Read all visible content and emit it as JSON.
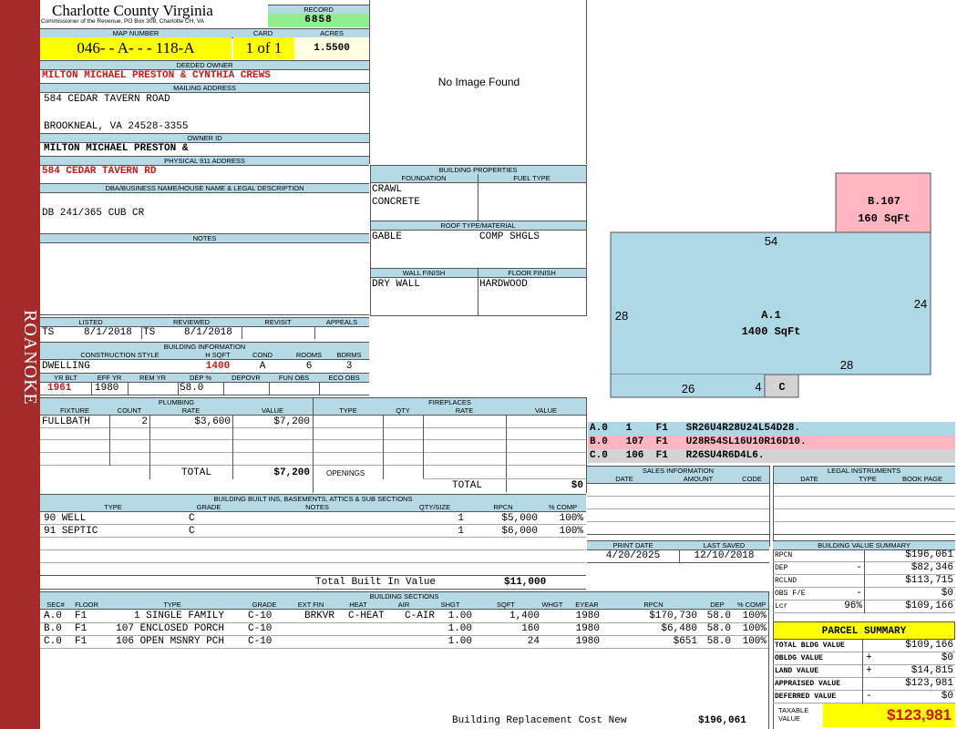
{
  "sidebar": {
    "district": "ROANOKE"
  },
  "header": {
    "county": "Charlotte County Virginia",
    "commissioner": "Commissioner of the Revenue, PO Box 308, Charlotte CH, VA",
    "record_label": "RECORD",
    "record": "6858",
    "map_label": "MAP NUMBER",
    "map_number": "046- - A- - - 118-A",
    "card_label": "CARD",
    "card": "1 of 1",
    "acres_label": "ACRES",
    "acres": "1.5500"
  },
  "owner": {
    "deeded_label": "DEEDED OWNER",
    "deeded": "MILTON MICHAEL PRESTON & CYNTHIA CREWS",
    "mailing_label": "MAILING ADDRESS",
    "mail1": "584 CEDAR TAVERN ROAD",
    "mail2": "BROOKNEAL, VA 24528-3355",
    "id_label": "OWNER ID",
    "owner_id": "MILTON MICHAEL PRESTON &",
    "phys_label": "PHYSICAL 911 ADDRESS",
    "phys": "584 CEDAR TAVERN RD"
  },
  "legal": {
    "label": "DBA/BUSINESS NAME/HOUSE NAME & LEGAL DESCRIPTION",
    "text": "DB 241/365 CUB CR"
  },
  "notes": {
    "label": "NOTES"
  },
  "image": {
    "text": "No Image Found"
  },
  "props": {
    "label": "BUILDING PROPERTIES",
    "foundation_label": "FOUNDATION",
    "fuel_label": "FUEL TYPE",
    "foundation1": "CRAWL",
    "foundation2": "CONCRETE",
    "roof_label": "ROOF TYPE/MATERIAL",
    "roof_type": "GABLE",
    "roof_mat": "COMP SHGLS",
    "wall_label": "WALL FINISH",
    "floor_label": "FLOOR FINISH",
    "wall": "DRY WALL",
    "floor": "HARDWOOD"
  },
  "listed": {
    "listed_label": "LISTED",
    "reviewed_label": "REVIEWED",
    "revisit_label": "REVISIT",
    "appeals_label": "APPEALS",
    "listed_by": "TS",
    "listed_date": "8/1/2018",
    "reviewed_by": "TS",
    "reviewed_date": "8/1/2018"
  },
  "bldg_info": {
    "label": "BUILDING INFORMATION",
    "style_label": "CONSTRUCTION STYLE",
    "hsqft_label": "H SQFT",
    "cond_label": "COND",
    "rooms_label": "ROOMS",
    "bdrms_label": "BDRMS",
    "style": "DWELLING",
    "hsqft": "1400",
    "cond": "A",
    "rooms": "6",
    "bdrms": "3",
    "yrblt_label": "YR BLT",
    "effyr_label": "EFF YR",
    "remyr_label": "REM YR",
    "dep_label": "DEP %",
    "depovr_label": "DEPOVR",
    "funobs_label": "FUN OBS",
    "ecoobs_label": "ECO OBS",
    "yrblt": "1961",
    "effyr": "1980",
    "dep": "58.0"
  },
  "plumbing": {
    "label": "PLUMBING",
    "cols": [
      "FIXTURE",
      "COUNT",
      "RATE",
      "VALUE"
    ],
    "rows": [
      {
        "fixture": "FULLBATH",
        "count": "2",
        "rate": "$3,600",
        "value": "$7,200"
      }
    ],
    "total_label": "TOTAL",
    "total": "$7,200"
  },
  "fireplaces": {
    "label": "FIREPLACES",
    "cols": [
      "TYPE",
      "QTY",
      "RATE",
      "VALUE"
    ],
    "openings": "OPENINGS",
    "total_label": "TOTAL",
    "total": "$0"
  },
  "builtins": {
    "label": "BUILDING BUILT INS, BASEMENTS, ATTICS & SUB SECTIONS",
    "cols": [
      "TYPE",
      "GRADE",
      "NOTES",
      "QTY/SIZE",
      "RPCN",
      "% COMP"
    ],
    "rows": [
      {
        "type": "90 WELL",
        "grade": "C",
        "qty": "1",
        "rpcn": "$5,000",
        "comp": "100%"
      },
      {
        "type": "91 SEPTIC",
        "grade": "C",
        "qty": "1",
        "rpcn": "$6,000",
        "comp": "100%"
      }
    ],
    "total_label": "Total Built In Value",
    "total": "$11,000"
  },
  "sections": {
    "label": "BUILDING SECTIONS",
    "cols": [
      "SEC#",
      "FLOOR",
      "TYPE",
      "GRADE",
      "EXT FIN",
      "HEAT",
      "AIR",
      "SHGT",
      "SQFT",
      "WHGT",
      "EYEAR",
      "RPCN",
      "DEP",
      "% COMP"
    ],
    "rows": [
      {
        "sec": "A.0",
        "floor": "F1",
        "type": "1 SINGLE FAMILY",
        "grade": "C-10",
        "ext": "BRKVR",
        "heat": "C-HEAT",
        "air": "C-AIR",
        "shgt": "1.00",
        "sqft": "1,400",
        "eyear": "1980",
        "rpcn": "$170,730",
        "dep": "58.0",
        "comp": "100%"
      },
      {
        "sec": "B.0",
        "floor": "F1",
        "type": "107 ENCLOSED PORCH",
        "grade": "C-10",
        "ext": "",
        "heat": "",
        "air": "",
        "shgt": "1.00",
        "sqft": "160",
        "eyear": "1980",
        "rpcn": "$6,480",
        "dep": "58.0",
        "comp": "100%"
      },
      {
        "sec": "C.0",
        "floor": "F1",
        "type": "106 OPEN MSNRY PCH",
        "grade": "C-10",
        "ext": "",
        "heat": "",
        "air": "",
        "shgt": "1.00",
        "sqft": "24",
        "eyear": "1980",
        "rpcn": "$651",
        "dep": "58.0",
        "comp": "100%"
      }
    ],
    "brc_label": "Building Replacement Cost New",
    "brc": "$196,061"
  },
  "sketch": {
    "a_label": "A.1",
    "a_sqft": "1400 SqFt",
    "b_label": "B.107",
    "b_sqft": "160 SqFt",
    "c_label": "C",
    "d54": "54",
    "d28l": "28",
    "d24": "24",
    "d28b": "28",
    "d26": "26",
    "d4": "4",
    "colors": {
      "a": "#add8e6",
      "b": "#ffb6c1",
      "c": "#d3d3d3"
    },
    "codes": [
      "A.0   1    F1   SR26U4R28U24L54D28.",
      "B.0   107  F1   U28R54SL16U10R16D10.",
      "C.0   106  F1   R26SU4R6D4L6."
    ]
  },
  "sales": {
    "label": "SALES INFORMATION",
    "cols": [
      "DATE",
      "AMOUNT",
      "CODE"
    ]
  },
  "legal_inst": {
    "label": "LEGAL INSTRUMENTS",
    "cols": [
      "DATE",
      "TYPE",
      "BOOK PAGE"
    ]
  },
  "print": {
    "print_label": "PRINT DATE",
    "saved_label": "LAST SAVED",
    "print_date": "4/20/2025",
    "saved": "12/10/2018"
  },
  "value_summary": {
    "label": "BUILDING VALUE SUMMARY",
    "rows": [
      {
        "k": "RPCN",
        "s": "",
        "v": "$196,061"
      },
      {
        "k": "DEP",
        "s": "-",
        "v": "$82,346"
      },
      {
        "k": "RCLND",
        "s": "",
        "v": "$113,715"
      },
      {
        "k": "OBS F/E",
        "s": "-",
        "v": "$0"
      },
      {
        "k": "Lcr",
        "s": "96%",
        "v": "$109,166"
      }
    ]
  },
  "parcel": {
    "label": "PARCEL SUMMARY",
    "rows": [
      {
        "k": "TOTAL BLDG VALUE",
        "s": "",
        "v": "$109,166"
      },
      {
        "k": "OBLDG VALUE",
        "s": "+",
        "v": "$0"
      },
      {
        "k": "LAND VALUE",
        "s": "+",
        "v": "$14,815"
      },
      {
        "k": "APPRAISED VALUE",
        "s": "",
        "v": "$123,981"
      },
      {
        "k": "DEFERRED VALUE",
        "s": "-",
        "v": "$0"
      }
    ],
    "taxable_label1": "TAXABLE",
    "taxable_label2": "VALUE",
    "taxable": "$123,981"
  }
}
